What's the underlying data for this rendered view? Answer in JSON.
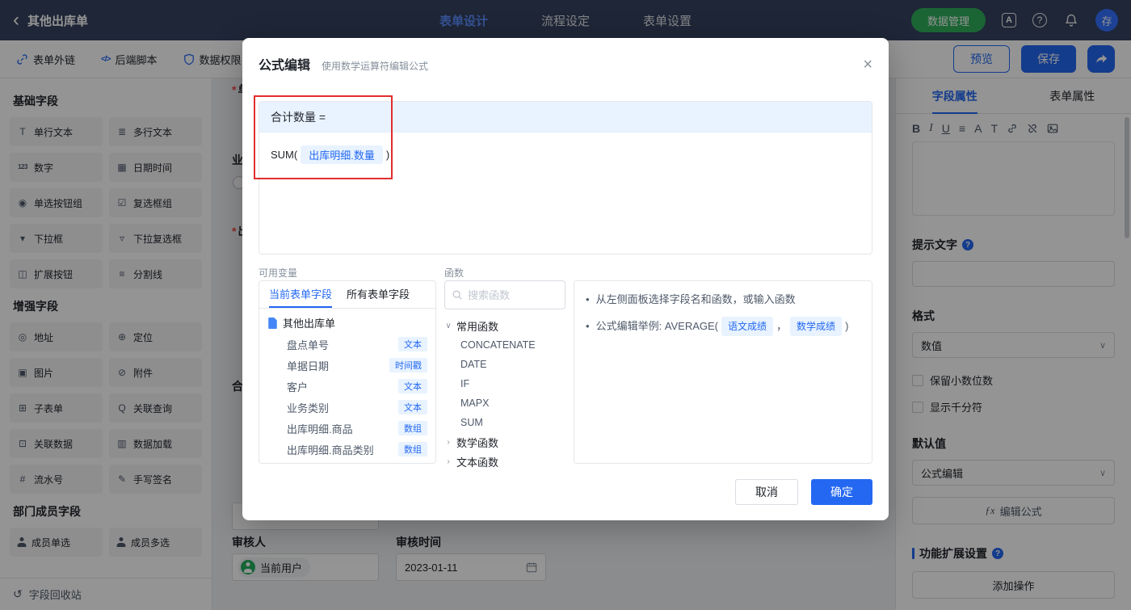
{
  "topbar": {
    "back_title": "其他出库单",
    "tabs": [
      {
        "label": "表单设计"
      },
      {
        "label": "流程设定"
      },
      {
        "label": "表单设置"
      }
    ],
    "data_manage": "数据管理",
    "avatar": "存"
  },
  "toolbar": {
    "items": [
      {
        "label": "表单外链"
      },
      {
        "label": "后端脚本"
      },
      {
        "label": "数据权限"
      }
    ],
    "preview": "预览",
    "save": "保存"
  },
  "sidebar": {
    "sections": [
      {
        "title": "基础字段",
        "fields": [
          {
            "label": "单行文本",
            "icon": "single-line-text-icon"
          },
          {
            "label": "多行文本",
            "icon": "multi-line-text-icon"
          },
          {
            "label": "数字",
            "icon": "number-icon"
          },
          {
            "label": "日期时间",
            "icon": "datetime-icon"
          },
          {
            "label": "单选按钮组",
            "icon": "radio-group-icon"
          },
          {
            "label": "复选框组",
            "icon": "checkbox-group-icon"
          },
          {
            "label": "下拉框",
            "icon": "select-icon"
          },
          {
            "label": "下拉复选框",
            "icon": "multi-select-icon"
          },
          {
            "label": "扩展按钮",
            "icon": "extend-button-icon"
          },
          {
            "label": "分割线",
            "icon": "divider-icon"
          }
        ]
      },
      {
        "title": "增强字段",
        "fields": [
          {
            "label": "地址",
            "icon": "address-icon"
          },
          {
            "label": "定位",
            "icon": "location-icon"
          },
          {
            "label": "图片",
            "icon": "image-field-icon"
          },
          {
            "label": "附件",
            "icon": "attachment-icon"
          },
          {
            "label": "子表单",
            "icon": "subform-icon"
          },
          {
            "label": "关联查询",
            "icon": "linked-query-icon"
          },
          {
            "label": "关联数据",
            "icon": "linked-data-icon"
          },
          {
            "label": "数据加载",
            "icon": "data-load-icon"
          },
          {
            "label": "流水号",
            "icon": "serial-number-icon"
          },
          {
            "label": "手写签名",
            "icon": "signature-icon"
          }
        ]
      },
      {
        "title": "部门成员字段",
        "fields": [
          {
            "label": "成员单选",
            "icon": "member-single-icon"
          },
          {
            "label": "成员多选",
            "icon": "member-multi-icon"
          }
        ]
      }
    ],
    "recycle": "字段回收站"
  },
  "canvas": {
    "required_mark": "*",
    "partial_fields": [
      {
        "label": "单",
        "required": true
      },
      {
        "label": "业",
        "required": false
      },
      {
        "label": "出",
        "required": true
      },
      {
        "label": "合",
        "required": false
      }
    ],
    "reviewer_label": "审核人",
    "reviewer_value": "当前用户",
    "review_time_label": "审核时间",
    "review_time_value": "2023-01-11"
  },
  "modal": {
    "title": "公式编辑",
    "subtitle": "使用数学运算符编辑公式",
    "formula": {
      "target": "合计数量 =",
      "fn": "SUM(",
      "chip": "出库明细.数量",
      "close": ")"
    },
    "vars_label": "可用变量",
    "fns_label": "函数",
    "variables": {
      "tabs": [
        "当前表单字段",
        "所有表单字段"
      ],
      "root": "其他出库单",
      "fields": [
        {
          "name": "盘点单号",
          "type": "文本"
        },
        {
          "name": "单据日期",
          "type": "时间戳"
        },
        {
          "name": "客户",
          "type": "文本"
        },
        {
          "name": "业务类别",
          "type": "文本"
        },
        {
          "name": "出库明细.商品",
          "type": "数组"
        },
        {
          "name": "出库明细.商品类别",
          "type": "数组"
        }
      ]
    },
    "functions": {
      "search_placeholder": "搜索函数",
      "groups": [
        {
          "name": "常用函数",
          "items": [
            "CONCATENATE",
            "DATE",
            "IF",
            "MAPX",
            "SUM"
          ]
        },
        {
          "name": "数学函数"
        },
        {
          "name": "文本函数"
        }
      ]
    },
    "help": {
      "line1": "从左侧面板选择字段名和函数，或输入函数",
      "line2_prefix": "公式编辑举例: AVERAGE(",
      "chip1": "语文成绩",
      "sep": "，",
      "chip2": "数学成绩",
      "close": ")"
    },
    "cancel": "取消",
    "confirm": "确定"
  },
  "props": {
    "tabs": [
      {
        "label": "字段属性"
      },
      {
        "label": "表单属性"
      }
    ],
    "hint_label": "提示文字",
    "format_label": "格式",
    "format_value": "数值",
    "opt_decimal": "保留小数位数",
    "opt_thousand": "显示千分符",
    "default_label": "默认值",
    "default_value": "公式编辑",
    "fx_button": "编辑公式",
    "ext_title": "功能扩展设置",
    "add_action": "添加操作"
  },
  "colors": {
    "primary": "#2468f2",
    "green": "#2fae5b",
    "chip_bg": "#e8f3ff",
    "annotation_red": "#e12d2d",
    "topbar_bg": "#34425f"
  }
}
